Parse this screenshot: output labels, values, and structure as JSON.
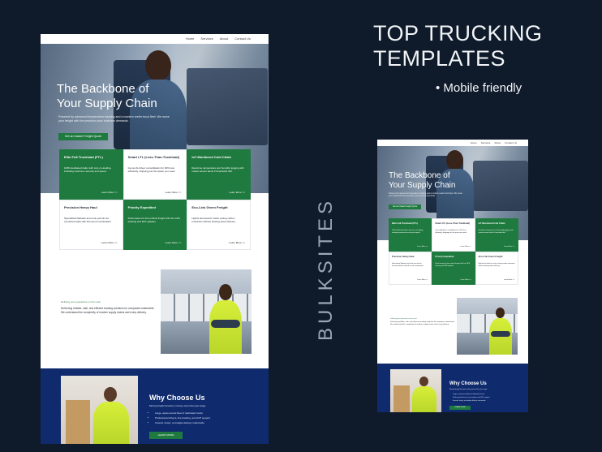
{
  "promo": {
    "title_line1": "TOP TRUCKING",
    "title_line2": "TEMPLATES",
    "bullet": "• Mobile friendly",
    "brand": "BULKSITES"
  },
  "site": {
    "nav": [
      "Home",
      "Services",
      "About",
      "Contact Us"
    ],
    "hero": {
      "title_line1": "The Backbone of",
      "title_line2": "Your Supply Chain",
      "subtitle": "Powered by advanced temperature tracking and a modern reefer truck fleet. We move your freight with the precision your business demands.",
      "button": "Get an Instant Freight Quote"
    },
    "services": [
      {
        "title": "Elite Full Truckload (FTL)",
        "desc": "100% dedicated trailer with zero co-loading, including maximum security and speed.",
        "link": "Learn More >>",
        "style": "green"
      },
      {
        "title": "Smart LTL (Less-Than-Truckload)",
        "desc": "Get an AI-driven consolidation for 30% less efficiently, shipping just the space you need.",
        "link": "Learn More >>",
        "style": "white"
      },
      {
        "title": "IoT-Monitored Cold Chain",
        "desc": "Real-time temperature and humidity logging with instant sensor alerts if thresholds drift.",
        "link": "Learn More >>",
        "style": "green"
      },
      {
        "title": "Precision Heavy Haul",
        "desc": "Specialized flatbeds and route permits for oversized loads with full escort coordination.",
        "link": "Learn More >>",
        "style": "white"
      },
      {
        "title": "Priority Expedited",
        "desc": "Rush teams for time-critical freight with live GPS tracking and ETA updates.",
        "link": "Learn More >>",
        "style": "green"
      },
      {
        "title": "Eco-Link Green Freight",
        "desc": "Hybrid and electric trucks cutting carbon emissions without slowing down delivery.",
        "link": "Learn More >>",
        "style": "white"
      }
    ],
    "promo_section": {
      "mini": "Defining your operations on the road",
      "text": "Delivering reliable, safe, and efficient trucking solutions for companies nationwide. We understand the complexity of modern supply chains and every delivery."
    },
    "why": {
      "title": "Why Choose Us",
      "text": "Moving freight forward, moving more than just cargo.",
      "bullets": [
        "Large, asset-owned fleet of dedicated trucks",
        "Professional drivers, live tracking, and 24/7 support",
        "Insured, timely, on-budget delivery nationwide"
      ],
      "button": "LEARN MORE"
    }
  },
  "colors": {
    "page_bg": "#0f1b2a",
    "accent_green": "#1f7a3f",
    "why_blue": "#0f2b6e"
  }
}
